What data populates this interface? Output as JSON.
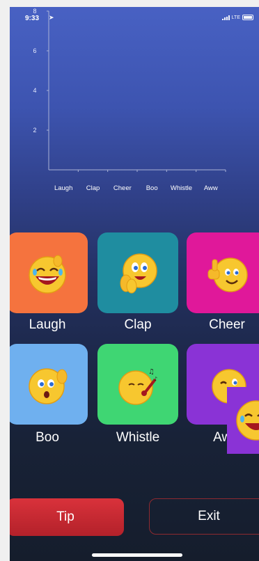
{
  "status_bar": {
    "time": "9:33",
    "location_icon": "location-arrow-icon",
    "network": "LTE"
  },
  "chart_data": {
    "type": "bar",
    "categories": [
      "Laugh",
      "Clap",
      "Cheer",
      "Boo",
      "Whistle",
      "Aww"
    ],
    "values": [
      0,
      0,
      0,
      0,
      0,
      0
    ],
    "yticks": [
      "8",
      "6",
      "4",
      "2"
    ],
    "ylim": [
      0,
      8
    ],
    "title": "",
    "xlabel": "",
    "ylabel": "",
    "grid": false
  },
  "reactions": [
    {
      "label": "Laugh",
      "color": "#f5733e",
      "icon": "laughing-emoji-icon"
    },
    {
      "label": "Clap",
      "color": "#1f8da0",
      "icon": "clapping-emoji-icon"
    },
    {
      "label": "Cheer",
      "color": "#e0189a",
      "icon": "thumbs-up-emoji-icon"
    },
    {
      "label": "Boo",
      "color": "#6fb0ef",
      "icon": "shocked-emoji-icon"
    },
    {
      "label": "Whistle",
      "color": "#3fd673",
      "icon": "whistle-emoji-icon"
    },
    {
      "label": "Aww",
      "color": "#8a33d6",
      "icon": "winking-emoji-icon"
    }
  ],
  "buttons": {
    "tip": "Tip",
    "exit": "Exit"
  }
}
